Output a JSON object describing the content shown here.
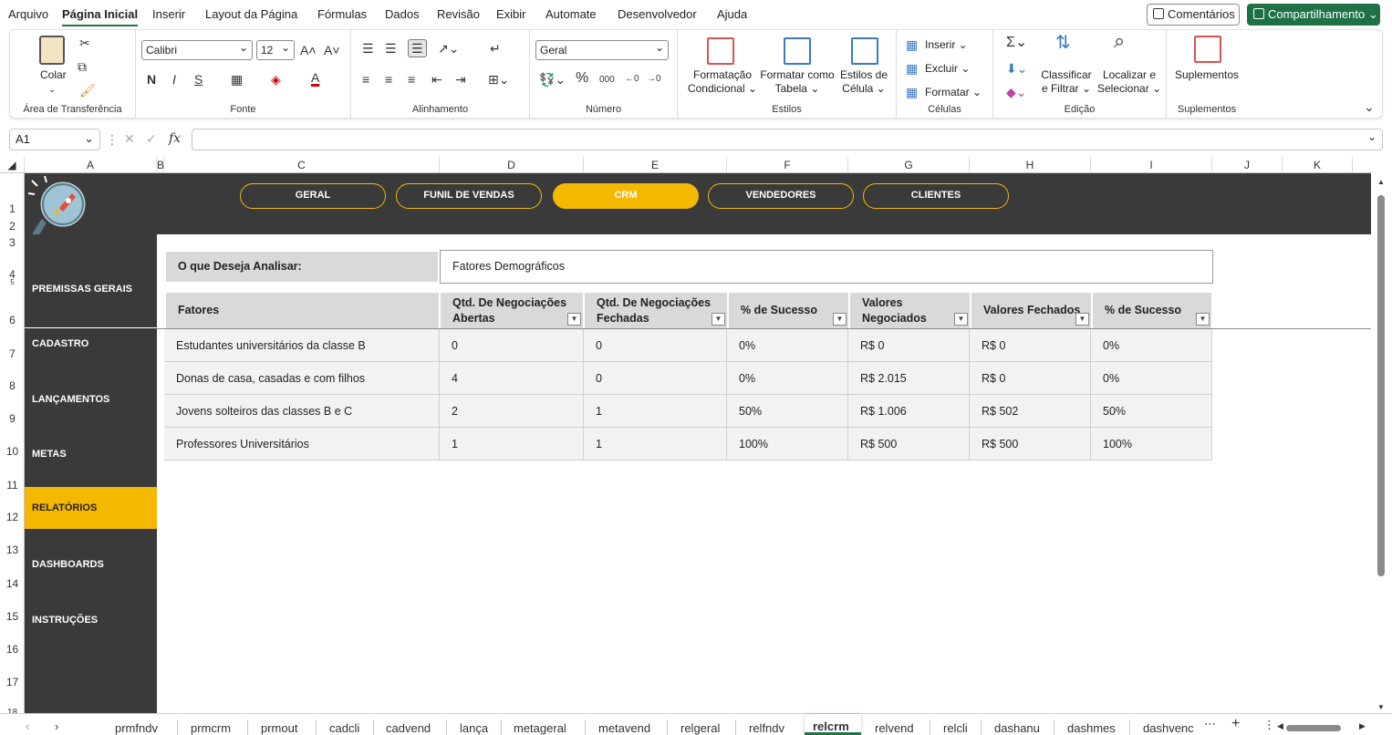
{
  "menu": {
    "items": [
      "Arquivo",
      "Página Inicial",
      "Inserir",
      "Layout da Página",
      "Fórmulas",
      "Dados",
      "Revisão",
      "Exibir",
      "Automate",
      "Desenvolvedor",
      "Ajuda"
    ],
    "comments": "Comentários",
    "share": "Compartilhamento"
  },
  "ribbon": {
    "clipboard": {
      "paste": "Colar",
      "label": "Área de Transferência"
    },
    "font": {
      "name": "Calibri",
      "size": "12",
      "bold": "N",
      "italic": "I",
      "underline": "S",
      "label": "Fonte"
    },
    "align": {
      "label": "Alinhamento"
    },
    "number": {
      "format": "Geral",
      "label": "Número"
    },
    "styles": {
      "cond1": "Formatação",
      "cond2": "Condicional",
      "table1": "Formatar como",
      "table2": "Tabela",
      "cell1": "Estilos de",
      "cell2": "Célula",
      "label": "Estilos"
    },
    "cells": {
      "insert": "Inserir",
      "delete": "Excluir",
      "format": "Formatar",
      "label": "Células"
    },
    "editing": {
      "sort1": "Classificar",
      "sort2": "e Filtrar",
      "find1": "Localizar e",
      "find2": "Selecionar",
      "label": "Edição"
    },
    "addins": {
      "name": "Suplementos",
      "label": "Suplementos"
    }
  },
  "formula": {
    "namebox": "A1",
    "fx": "fx"
  },
  "columns": [
    "A",
    "B",
    "C",
    "D",
    "E",
    "F",
    "G",
    "H",
    "I",
    "J",
    "K"
  ],
  "rows": [
    "1",
    "2",
    "3",
    "4",
    "5",
    "6",
    "7",
    "8",
    "9",
    "10",
    "11",
    "12",
    "13",
    "14",
    "15",
    "16",
    "17",
    "18"
  ],
  "nav": {
    "tabs": [
      "GERAL",
      "FUNIL DE VENDAS",
      "CRM",
      "VENDEDORES",
      "CLIENTES"
    ],
    "active": "CRM"
  },
  "sidebar": {
    "items": [
      "PREMISSAS GERAIS",
      "CADASTRO",
      "LANÇAMENTOS",
      "METAS",
      "RELATÓRIOS",
      "DASHBOARDS",
      "INSTRUÇÕES"
    ],
    "active": "RELATÓRIOS"
  },
  "analysis": {
    "label": "O que Deseja Analisar:",
    "value": "Fatores Demográficos"
  },
  "table": {
    "headers": [
      "Fatores",
      "Qtd. De Negociações Abertas",
      "Qtd. De Negociações Fechadas",
      "% de Sucesso",
      "Valores Negociados",
      "Valores Fechados",
      "% de Sucesso"
    ],
    "rows": [
      [
        "Estudantes universitários da classe B",
        "0",
        "0",
        "0%",
        "R$ 0",
        "R$ 0",
        "0%"
      ],
      [
        "Donas de casa, casadas e com filhos",
        "4",
        "0",
        "0%",
        "R$ 2.015",
        "R$ 0",
        "0%"
      ],
      [
        "Jovens solteiros das classes B e C",
        "2",
        "1",
        "50%",
        "R$ 1.006",
        "R$ 502",
        "50%"
      ],
      [
        "Professores Universitários",
        "1",
        "1",
        "100%",
        "R$ 500",
        "R$ 500",
        "100%"
      ]
    ]
  },
  "sheets": {
    "tabs": [
      "prmfndv",
      "prmcrm",
      "prmout",
      "cadcli",
      "cadvend",
      "lança",
      "metageral",
      "metavend",
      "relgeral",
      "relfndv",
      "relcrm",
      "relvend",
      "relcli",
      "dashanu",
      "dashmes",
      "dashvenc"
    ],
    "active": "relcrm"
  }
}
